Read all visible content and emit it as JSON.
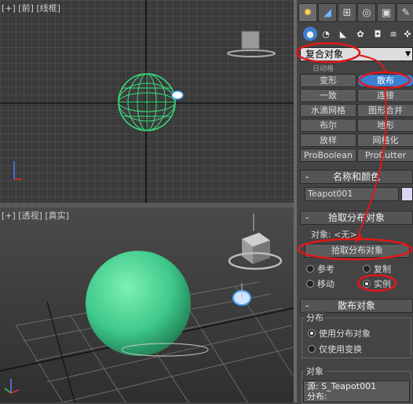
{
  "viewports": {
    "top_label": "[+] [前] [线框]",
    "persp_label": "[+] [透视] [真实]"
  },
  "panel": {
    "tabs": [
      "create-icon",
      "modify-icon",
      "hierarchy-icon",
      "motion-icon",
      "display-icon",
      "utilities-icon"
    ],
    "subtabs": [
      "geometry-icon",
      "shapes-icon",
      "lights-icon",
      "cameras-icon",
      "helpers-icon",
      "spacewarps-icon",
      "systems-icon"
    ],
    "category": "复合对象",
    "obj_type_partial": "日动格",
    "buttons": [
      [
        "变形",
        "散布"
      ],
      [
        "一致",
        "连接"
      ],
      [
        "水滴网格",
        "图形合并"
      ],
      [
        "布尔",
        "地形"
      ],
      [
        "放样",
        "网格化"
      ],
      [
        "ProBoolean",
        "ProCutter"
      ]
    ],
    "name_color": {
      "title": "名称和颜色",
      "sign": "-",
      "name": "Teapot001",
      "color": "#dcd5f2"
    },
    "pick": {
      "title": "拾取分布对象",
      "sign": "-",
      "object_label": "对象: <无>",
      "pick_button": "拾取分布对象",
      "reference": "参考",
      "copy": "复制",
      "move": "移动",
      "instance": "实例"
    },
    "scatter": {
      "title": "散布对象",
      "sign": "-",
      "dist_group": "分布",
      "use_dist": "使用分布对象",
      "transform_only": "仅使用变换",
      "objects_group": "对象",
      "source": "源: S_Teapot001",
      "distribute": "分布:"
    }
  }
}
